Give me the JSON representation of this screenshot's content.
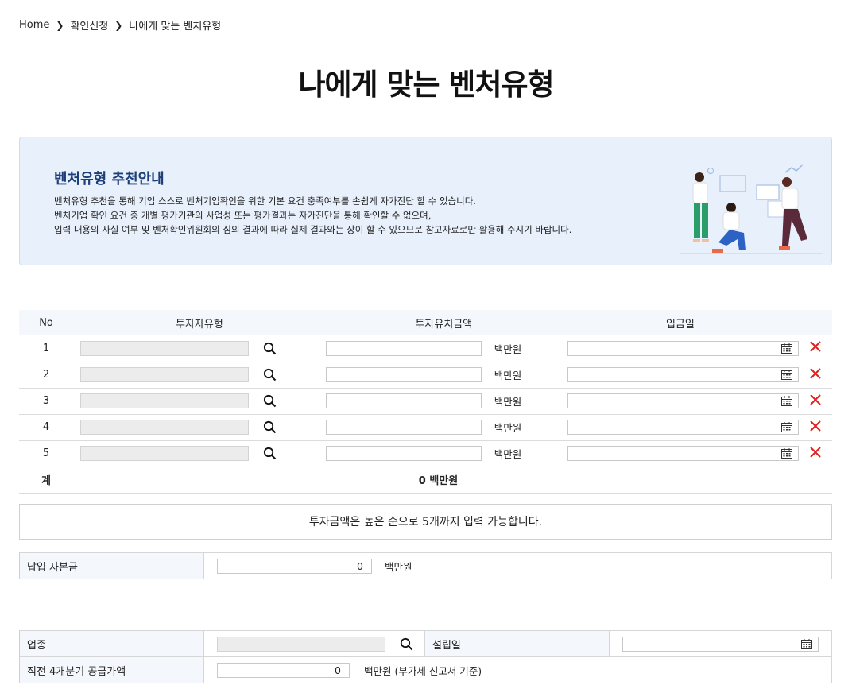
{
  "breadcrumb": {
    "home": "Home",
    "level1": "확인신청",
    "level2": "나에게 맞는 벤처유형"
  },
  "page_title": "나에게 맞는 벤처유형",
  "guide": {
    "title": "벤처유형 추천안내",
    "line1": "벤처유형 추천을 통해 기업 스스로 벤처기업확인을 위한 기본 요건 충족여부를 손쉽게 자가진단 할 수 있습니다.",
    "line2": "벤처기업 확인 요건 중 개별 평가기관의 사업성 또는 평가결과는 자가진단을 통해 확인할 수 없으며,",
    "line3": "입력 내용의 사실 여부 및 벤처확인위원회의 심의 결과에 따라 실제 결과와는 상이 할 수 있으므로 참고자료로만 활용해 주시기 바랍니다."
  },
  "invest_table": {
    "headers": {
      "no": "No",
      "type": "투자자유형",
      "amount": "투자유치금액",
      "date": "입금일"
    },
    "unit": "백만원",
    "rows": [
      {
        "no": "1",
        "type": "",
        "amount": "",
        "date": ""
      },
      {
        "no": "2",
        "type": "",
        "amount": "",
        "date": ""
      },
      {
        "no": "3",
        "type": "",
        "amount": "",
        "date": ""
      },
      {
        "no": "4",
        "type": "",
        "amount": "",
        "date": ""
      },
      {
        "no": "5",
        "type": "",
        "amount": "",
        "date": ""
      }
    ],
    "sum_label": "계",
    "sum_value": "0 백만원"
  },
  "notice": "투자금액은 높은 순으로 5개까지 입력 가능합니다.",
  "capital": {
    "label": "납입 자본금",
    "value": "0",
    "unit": "백만원"
  },
  "company": {
    "industry_label": "업종",
    "industry_value": "",
    "founded_label": "설립일",
    "founded_value": "",
    "supply_label": "직전 4개분기 공급가액",
    "supply_value": "0",
    "supply_unit": "백만원 (부가세 신고서 기준)"
  },
  "colors": {
    "accent_blue": "#1c3f7a",
    "guide_bg": "#e8f0fc",
    "header_bg": "#f4f7fc",
    "delete_red": "#e02020"
  },
  "icons": {
    "search": "search-icon",
    "calendar": "calendar-icon",
    "delete": "close-icon",
    "chevron": "chevron-right-icon"
  }
}
